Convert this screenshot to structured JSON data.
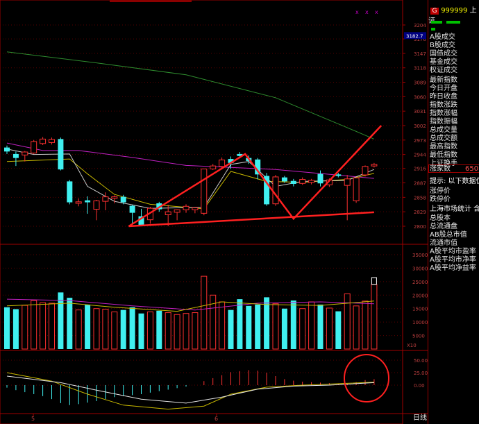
{
  "chart_data": {
    "type": "candlestick",
    "price_axis": {
      "ticks": [
        2800,
        2829,
        2858,
        2887,
        2916,
        2944,
        2973,
        3002,
        3031,
        3060,
        3089,
        3118,
        3147,
        3176,
        3204
      ],
      "marker": "3182.7"
    },
    "volume_axis": {
      "ticks": [
        5000,
        10000,
        15000,
        20000,
        25000,
        30000,
        35000
      ],
      "multiplier": "X10"
    },
    "macd_axis": {
      "ticks": [
        "50.00",
        "25.00",
        "0.00"
      ]
    },
    "x_ticks": [
      "5",
      "6"
    ],
    "candles": [
      {
        "o": 2958,
        "c": 2950,
        "h": 2962,
        "l": 2945
      },
      {
        "o": 2945,
        "c": 2937,
        "h": 2950,
        "l": 2921
      },
      {
        "o": 2943,
        "c": 2949,
        "h": 2951,
        "l": 2930
      },
      {
        "o": 2947,
        "c": 2970,
        "h": 2973,
        "l": 2945
      },
      {
        "o": 2966,
        "c": 2975,
        "h": 2979,
        "l": 2963
      },
      {
        "o": 2968,
        "c": 2974,
        "h": 2978,
        "l": 2964
      },
      {
        "o": 2975,
        "c": 2914,
        "h": 2978,
        "l": 2912
      },
      {
        "o": 2890,
        "c": 2848,
        "h": 2893,
        "l": 2844
      },
      {
        "o": 2846,
        "c": 2849,
        "h": 2856,
        "l": 2840
      },
      {
        "o": 2852,
        "c": 2848,
        "h": 2860,
        "l": 2825
      },
      {
        "o": 2834,
        "c": 2851,
        "h": 2853,
        "l": 2812
      },
      {
        "o": 2850,
        "c": 2859,
        "h": 2868,
        "l": 2832
      },
      {
        "o": 2856,
        "c": 2859,
        "h": 2862,
        "l": 2846
      },
      {
        "o": 2859,
        "c": 2848,
        "h": 2863,
        "l": 2844
      },
      {
        "o": 2841,
        "c": 2827,
        "h": 2843,
        "l": 2805
      },
      {
        "o": 2820,
        "c": 2802,
        "h": 2835,
        "l": 2800
      },
      {
        "o": 2813,
        "c": 2836,
        "h": 2839,
        "l": 2805
      },
      {
        "o": 2846,
        "c": 2834,
        "h": 2849,
        "l": 2829
      },
      {
        "o": 2823,
        "c": 2829,
        "h": 2843,
        "l": 2800
      },
      {
        "o": 2828,
        "c": 2833,
        "h": 2834,
        "l": 2812
      },
      {
        "o": 2833,
        "c": 2840,
        "h": 2844,
        "l": 2827
      },
      {
        "o": 2833,
        "c": 2837,
        "h": 2836,
        "l": 2826
      },
      {
        "o": 2826,
        "c": 2915,
        "h": 2915,
        "l": 2822
      },
      {
        "o": 2915,
        "c": 2921,
        "h": 2925,
        "l": 2913
      },
      {
        "o": 2920,
        "c": 2933,
        "h": 2938,
        "l": 2915
      },
      {
        "o": 2935,
        "c": 2927,
        "h": 2940,
        "l": 2915
      },
      {
        "o": 2945,
        "c": 2941,
        "h": 2949,
        "l": 2938
      },
      {
        "o": 2937,
        "c": 2931,
        "h": 2942,
        "l": 2925
      },
      {
        "o": 2934,
        "c": 2904,
        "h": 2937,
        "l": 2894
      },
      {
        "o": 2901,
        "c": 2844,
        "h": 2907,
        "l": 2841
      },
      {
        "o": 2845,
        "c": 2899,
        "h": 2903,
        "l": 2841
      },
      {
        "o": 2898,
        "c": 2890,
        "h": 2901,
        "l": 2887
      },
      {
        "o": 2891,
        "c": 2885,
        "h": 2895,
        "l": 2880
      },
      {
        "o": 2886,
        "c": 2894,
        "h": 2898,
        "l": 2883
      },
      {
        "o": 2888,
        "c": 2892,
        "h": 2895,
        "l": 2884
      },
      {
        "o": 2905,
        "c": 2886,
        "h": 2912,
        "l": 2880
      },
      {
        "o": 2883,
        "c": 2893,
        "h": 2896,
        "l": 2879
      },
      {
        "o": 2904,
        "c": 2901,
        "h": 2907,
        "l": 2898
      },
      {
        "o": 2882,
        "c": 2895,
        "h": 2903,
        "l": 2812
      },
      {
        "o": 2851,
        "c": 2897,
        "h": 2898,
        "l": 2847
      },
      {
        "o": 2903,
        "c": 2920,
        "h": 2922,
        "l": 2900
      },
      {
        "o": 2921,
        "c": 2924,
        "h": 2927,
        "l": 2918
      }
    ],
    "volumes": [
      15500,
      14800,
      16200,
      18000,
      17200,
      17000,
      21000,
      19000,
      14500,
      16500,
      15000,
      14800,
      13800,
      14500,
      15500,
      13200,
      13800,
      14200,
      13500,
      12800,
      13200,
      13500,
      27000,
      20000,
      17500,
      14500,
      18500,
      16000,
      16500,
      19200,
      16800,
      15000,
      18000,
      15000,
      17500,
      16500,
      15200,
      14000,
      20500,
      16000,
      17800,
      24000
    ],
    "volume_highlight": 26500,
    "ma_price": [
      {
        "color": "#2e8b2e",
        "points": [
          [
            0,
            3150
          ],
          [
            10,
            3128
          ],
          [
            20,
            3104
          ],
          [
            30,
            3058
          ],
          [
            38,
            2998
          ],
          [
            41,
            2975
          ]
        ]
      },
      {
        "color": "#c020c0",
        "points": [
          [
            0,
            2967
          ],
          [
            4,
            2952
          ],
          [
            8,
            2952
          ],
          [
            14,
            2938
          ],
          [
            20,
            2922
          ],
          [
            30,
            2914
          ],
          [
            38,
            2901
          ],
          [
            41,
            2896
          ]
        ]
      },
      {
        "color": "#c8b800",
        "points": [
          [
            0,
            2930
          ],
          [
            7,
            2935
          ],
          [
            9,
            2905
          ],
          [
            12,
            2864
          ],
          [
            16,
            2844
          ],
          [
            22,
            2835
          ],
          [
            25,
            2910
          ],
          [
            29,
            2890
          ],
          [
            33,
            2888
          ],
          [
            38,
            2894
          ],
          [
            41,
            2906
          ]
        ]
      },
      {
        "color": "#c8c8c8",
        "points": [
          [
            0,
            2955
          ],
          [
            3,
            2944
          ],
          [
            7,
            2945
          ],
          [
            9,
            2880
          ],
          [
            12,
            2850
          ],
          [
            16,
            2836
          ],
          [
            22,
            2838
          ],
          [
            25,
            2924
          ],
          [
            27,
            2930
          ],
          [
            30,
            2880
          ],
          [
            33,
            2890
          ],
          [
            38,
            2892
          ],
          [
            41,
            2914
          ]
        ]
      }
    ],
    "ma_volume": [
      {
        "color": "#c020c0",
        "points": [
          [
            0,
            18500
          ],
          [
            7,
            18000
          ],
          [
            14,
            16000
          ],
          [
            21,
            14500
          ],
          [
            28,
            17000
          ],
          [
            35,
            17500
          ],
          [
            41,
            16800
          ]
        ]
      },
      {
        "color": "#c8b800",
        "points": [
          [
            0,
            16000
          ],
          [
            7,
            17000
          ],
          [
            12,
            15500
          ],
          [
            19,
            14000
          ],
          [
            24,
            17500
          ],
          [
            29,
            16500
          ],
          [
            35,
            16200
          ],
          [
            41,
            17800
          ]
        ]
      }
    ],
    "macd_bars": [
      -5,
      -10,
      -14,
      -18,
      -22,
      -28,
      -36,
      -40,
      -38,
      -35,
      -32,
      -28,
      -24,
      -22,
      -20,
      -18,
      -15,
      -12,
      -9,
      -6,
      -3,
      0,
      8,
      14,
      20,
      26,
      28,
      30,
      29,
      25,
      18,
      12,
      9,
      7,
      6,
      5,
      4,
      3,
      3,
      6,
      10,
      12
    ],
    "macd_lines": [
      {
        "color": "#c8b800",
        "points": [
          [
            0,
            25
          ],
          [
            5,
            8
          ],
          [
            9,
            -18
          ],
          [
            13,
            -40
          ],
          [
            18,
            -48
          ],
          [
            22,
            -42
          ],
          [
            25,
            -18
          ],
          [
            29,
            -4
          ],
          [
            33,
            0
          ],
          [
            41,
            6
          ]
        ]
      },
      {
        "color": "#e6e6e6",
        "points": [
          [
            0,
            18
          ],
          [
            6,
            5
          ],
          [
            10,
            -10
          ],
          [
            15,
            -28
          ],
          [
            20,
            -36
          ],
          [
            24,
            -24
          ],
          [
            28,
            -8
          ],
          [
            32,
            -2
          ],
          [
            36,
            0
          ],
          [
            41,
            5
          ]
        ]
      }
    ],
    "trendlines": [
      {
        "color": "#ff2020",
        "points": [
          [
            13.6,
            2800
          ],
          [
            26.6,
            2945
          ],
          [
            32,
            2815
          ],
          [
            41.8,
            3002
          ]
        ]
      },
      {
        "color": "#ff2020",
        "points": [
          [
            13.6,
            2800
          ],
          [
            41,
            2828
          ]
        ]
      }
    ]
  },
  "right_panel": {
    "code": "999999",
    "name": "上证",
    "tag": "G",
    "items_top": [
      "A股成交",
      "B股成交",
      "国债成交",
      "基金成交",
      "权证成交"
    ],
    "items_mid": [
      "最新指数",
      "今日开盘",
      "昨日收盘",
      "指数涨跌",
      "指数涨幅",
      "指数振幅",
      "总成交量",
      "总成交额",
      "最高指数",
      "最低指数",
      "上证换手"
    ],
    "home_label": "涨家数",
    "home_value": "650",
    "hint": "提示: 以下数据仅",
    "items_mid2": [
      "涨停价",
      "跌停价"
    ],
    "stats_title": "上海市场统计 含",
    "items_bottom": [
      "总股本",
      "总流通盘",
      "AB股总市值",
      "流通市值",
      "A股平均市盈率",
      "A股平均市净率",
      "A股平均净益率"
    ],
    "daily_label": "日线"
  }
}
